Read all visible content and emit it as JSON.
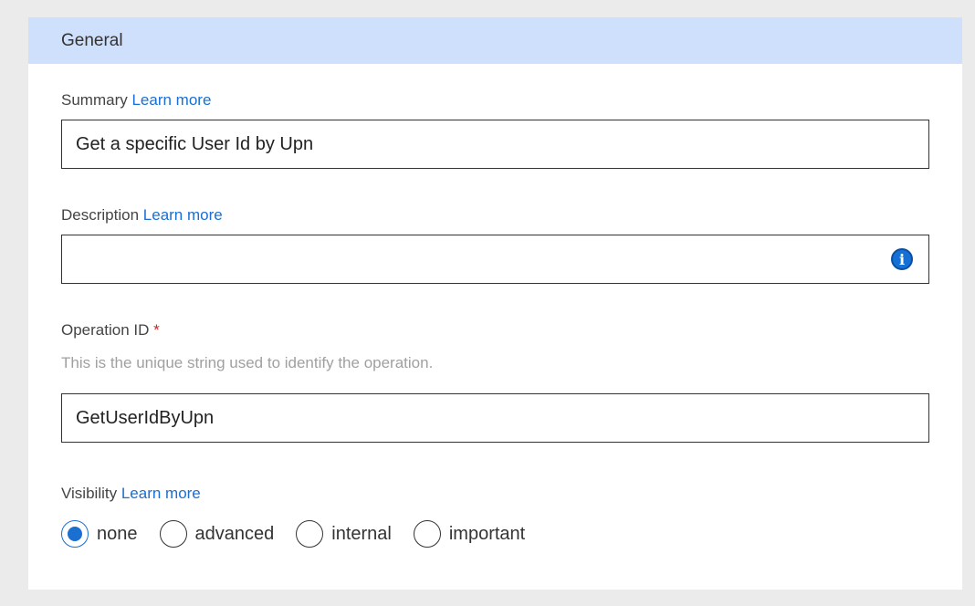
{
  "section": {
    "title": "General"
  },
  "summary": {
    "label": "Summary",
    "link": "Learn more",
    "value": "Get a specific User Id by Upn"
  },
  "description": {
    "label": "Description",
    "link": "Learn more",
    "value": "",
    "icon": "info-icon"
  },
  "operation_id": {
    "label": "Operation ID",
    "required_marker": "*",
    "hint": "This is the unique string used to identify the operation.",
    "value": "GetUserIdByUpn"
  },
  "visibility": {
    "label": "Visibility",
    "link": "Learn more",
    "selected": "none",
    "options": [
      "none",
      "advanced",
      "internal",
      "important"
    ]
  },
  "colors": {
    "header_bg": "#cfe0fc",
    "accent": "#1a6fd1",
    "required": "#c62828"
  }
}
